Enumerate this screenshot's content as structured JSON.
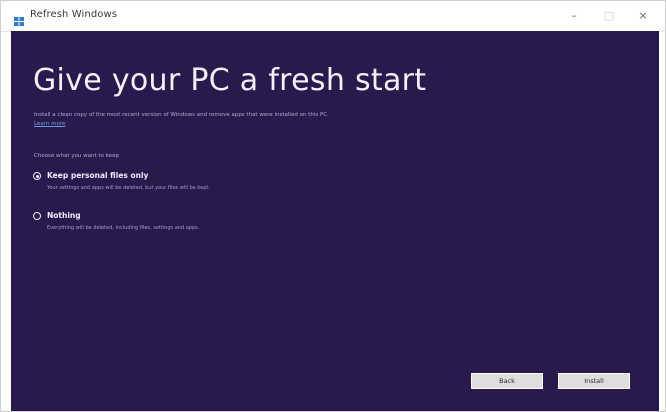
{
  "window": {
    "title": "Refresh Windows",
    "icon": "windows-logo-icon",
    "controls": {
      "minimize": "–",
      "maximize": "□",
      "close": "×"
    }
  },
  "page": {
    "heading": "Give your PC a fresh start",
    "description": "Install a clean copy of the most recent version of Windows and remove apps that were installed on this PC.",
    "learn_more": "Learn more",
    "choose_label": "Choose what you want to keep",
    "options": [
      {
        "label": "Keep personal files only",
        "description": "Your settings and apps will be deleted, but your files will be kept.",
        "selected": true
      },
      {
        "label": "Nothing",
        "description": "Everything will be deleted, including files, settings and apps.",
        "selected": false
      }
    ]
  },
  "buttons": {
    "back": "Back",
    "install": "Install"
  },
  "colors": {
    "background": "#281a4d",
    "heading": "#f4f1fb",
    "link": "#6f9be4",
    "button": "#dedde0"
  }
}
